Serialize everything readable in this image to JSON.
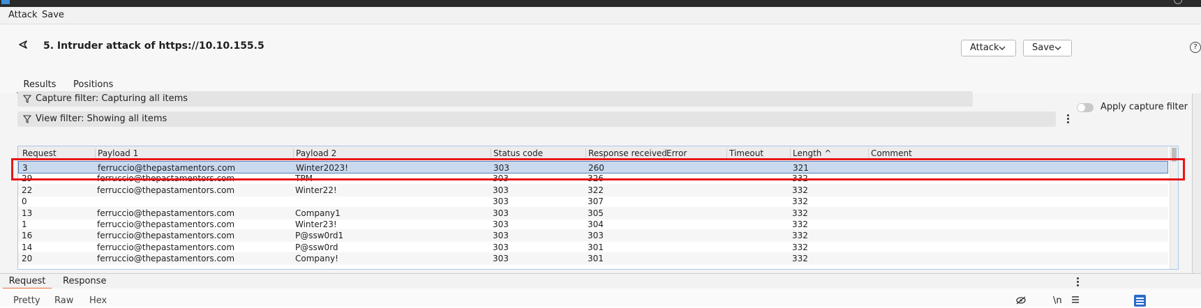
{
  "menu": {
    "attack": "Attack",
    "save": "Save"
  },
  "header": {
    "title": "5. Intruder attack of https://10.10.155.5",
    "attack_btn": "Attack",
    "save_btn": "Save",
    "help": "?"
  },
  "tabs": {
    "results": "Results",
    "positions": "Positions"
  },
  "filters": {
    "capture": "Capture filter: Capturing all items",
    "view": "View filter: Showing all items",
    "apply_capture": "Apply capture filter"
  },
  "table": {
    "columns": [
      "Request",
      "Payload 1",
      "Payload 2",
      "Status code",
      "Response received",
      "Error",
      "Timeout",
      "Length ^",
      "Comment"
    ],
    "rows": [
      [
        "3",
        "ferruccio@thepastamentors.com",
        "Winter2023!",
        "303",
        "260",
        "",
        "",
        "321",
        ""
      ],
      [
        "29",
        "ferruccio@thepastamentors.com",
        "TPM",
        "303",
        "326",
        "",
        "",
        "332",
        ""
      ],
      [
        "22",
        "ferruccio@thepastamentors.com",
        "Winter22!",
        "303",
        "322",
        "",
        "",
        "332",
        ""
      ],
      [
        "0",
        "",
        "",
        "303",
        "307",
        "",
        "",
        "332",
        ""
      ],
      [
        "13",
        "ferruccio@thepastamentors.com",
        "Company1",
        "303",
        "305",
        "",
        "",
        "332",
        ""
      ],
      [
        "1",
        "ferruccio@thepastamentors.com",
        "Winter23!",
        "303",
        "304",
        "",
        "",
        "332",
        ""
      ],
      [
        "16",
        "ferruccio@thepastamentors.com",
        "P@ssw0rd1",
        "303",
        "303",
        "",
        "",
        "332",
        ""
      ],
      [
        "14",
        "ferruccio@thepastamentors.com",
        "P@ssw0rd",
        "303",
        "301",
        "",
        "",
        "332",
        ""
      ],
      [
        "20",
        "ferruccio@thepastamentors.com",
        "Company!",
        "303",
        "301",
        "",
        "",
        "332",
        ""
      ]
    ]
  },
  "bottom": {
    "request": "Request",
    "response": "Response",
    "pretty": "Pretty",
    "raw": "Raw",
    "hex": "Hex",
    "newline": "\\n"
  },
  "colors": {
    "accent": "#e8703a",
    "highlight": "#e81515",
    "selection": "#c9d9ee"
  }
}
